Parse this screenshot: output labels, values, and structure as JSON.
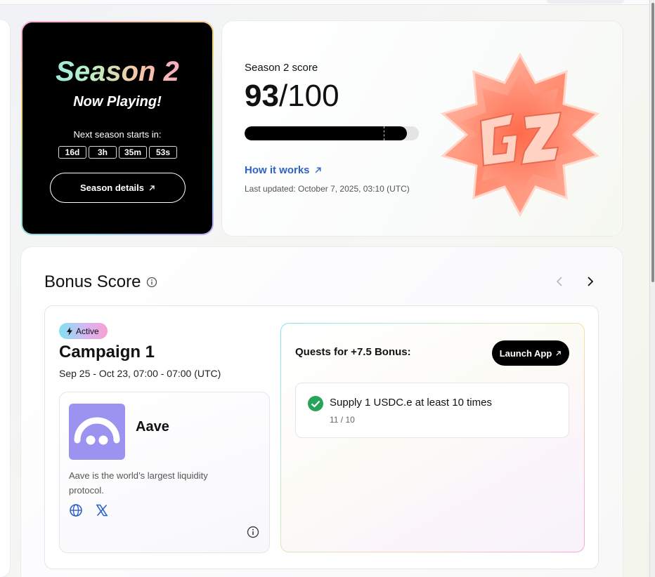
{
  "season": {
    "title": "Season 2",
    "subtitle": "Now Playing!",
    "next_label": "Next season starts in:",
    "countdown": {
      "days": "16d",
      "hours": "3h",
      "minutes": "35m",
      "seconds": "53s"
    },
    "details_button": "Season details",
    "details_icon": "arrow-up-right-icon"
  },
  "score": {
    "label": "Season 2 score",
    "value": "93",
    "max": "/100",
    "progress_fraction": 0.93,
    "how_link": "How it works",
    "last_updated": "Last updated: October 7, 2025, 03:10 (UTC)",
    "badge_icon": "season-2-badge"
  },
  "bonus": {
    "title": "Bonus Score",
    "campaign": {
      "status": "Active",
      "title": "Campaign 1",
      "dates": "Sep 25 - Oct 23, 07:00 - 07:00 (UTC)"
    },
    "project": {
      "name": "Aave",
      "description": "Aave is the world’s largest liquidity protocol.",
      "logo_color": "#9c92f0"
    },
    "quests": {
      "title": "Quests for +7.5 Bonus:",
      "launch_button": "Launch App",
      "items": [
        {
          "text": "Supply 1 USDC.e at least 10 times",
          "progress": "11 / 10",
          "completed": true
        }
      ]
    }
  },
  "colors": {
    "link": "#2d62c6",
    "check": "#27a35a",
    "aave": "#9c92f0"
  }
}
